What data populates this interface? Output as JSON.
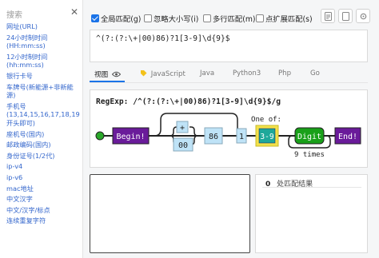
{
  "sidebar": {
    "search_placeholder": "搜索",
    "items": [
      "网址(URL)",
      "24小时制时间(HH:mm:ss)",
      "12小时制时间(hh:mm:ss)",
      "银行卡号",
      "车牌号(新能源+非新能源)",
      "手机号(13,14,15,16,17,18,19开头即可)",
      "座机号(国内)",
      "邮政编码(国内)",
      "身份证号(1/2代)",
      "ip-v4",
      "ip-v6",
      "mac地址",
      "中文汉字",
      "中文/汉字/标点",
      "连续重复字符"
    ]
  },
  "options": {
    "global": "全局匹配(g)",
    "ignore_case": "忽略大小写(i)",
    "multiline": "多行匹配(m)",
    "dotall": "点扩展匹配(s)"
  },
  "regex": {
    "value": "^(?:(?:\\+|00)86)?1[3-9]\\d{9}$"
  },
  "tabs": [
    "视图",
    "JavaScript",
    "Java",
    "Python3",
    "Php",
    "Go"
  ],
  "diagram": {
    "title": "RegExp: /^(?:(?:\\+|00)86)?1[3-9]\\d{9}$/g",
    "begin_label": "Begin!",
    "plus_label": "+",
    "zerozero_label": "00",
    "eightsix_label": "86",
    "one_label": "1",
    "oneof_caption": "One of:",
    "range_label": "3-9",
    "digit_label": "Digit",
    "times_caption": "9 times",
    "end_label": "End!"
  },
  "result": {
    "count": "0",
    "label": "处匹配结果"
  },
  "colors": {
    "accent": "#1a73e8",
    "terminal": "#6a1b9a",
    "literal": "#bfe3f7",
    "class_fill": "#1ea89a",
    "class_border": "#f2e24a",
    "digit_fill": "#19a019",
    "start_dot": "#2aa82a"
  }
}
